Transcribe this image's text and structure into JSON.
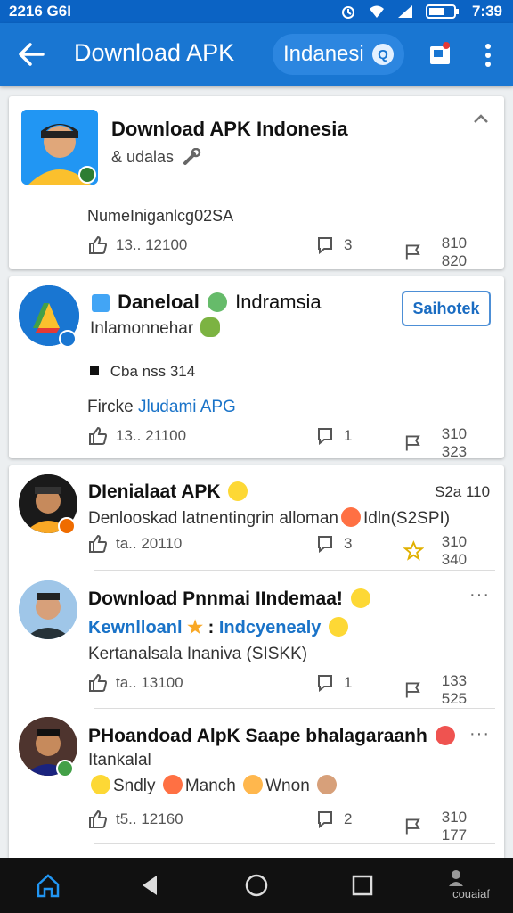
{
  "status_bar": {
    "left_text": "2216 G6I",
    "time": "7:39"
  },
  "app_bar": {
    "title": "Download APK",
    "language": "Indanesi"
  },
  "card1": {
    "title": "Download APK Indonesia",
    "subtitle": "& udalas",
    "body": "NumeIniganlcg02SA",
    "likes": "13.. 12100",
    "comments": "3",
    "shares": "810 820"
  },
  "card2": {
    "title_a": "Daneloal",
    "title_b": "Indramsia",
    "subtitle": "Inlamonnehar",
    "button": "Saihotek",
    "meta": "Cba nss 314",
    "link_prefix": "Fircke",
    "link": "Jludami APG",
    "likes": "13.. 21100",
    "comments": "1",
    "shares": "310 323"
  },
  "posts": [
    {
      "title": "DIenialaat APK",
      "meta": "S2a 110",
      "line1": "Denlooskad latnentingrin alloman",
      "line1b": "Idln(S2SPI)",
      "likes": "ta.. 20110",
      "comments": "3",
      "shares": "310 340"
    },
    {
      "title": "Download Pnnmai IIndemaa!",
      "line1": "Kewnlloanl",
      "line1b": "Indcyenealy",
      "line2": "Kertanalsala Inaniva (SISKK)",
      "likes": "ta.. 13100",
      "comments": "1",
      "shares": "133 525"
    },
    {
      "title": "PHoandoad AlpK Saape bhalagaraanh",
      "line1": "Itankalal",
      "line2a": "Sndly",
      "line2b": "Manch",
      "line2c": "Wnon",
      "likes": "t5.. 12160",
      "comments": "2",
      "shares": "310 177"
    }
  ],
  "nav_bar": {
    "label": "couaiaf"
  },
  "colors": {
    "primary": "#1976d2",
    "status": "#0b63c4",
    "link": "#1a73c8"
  }
}
